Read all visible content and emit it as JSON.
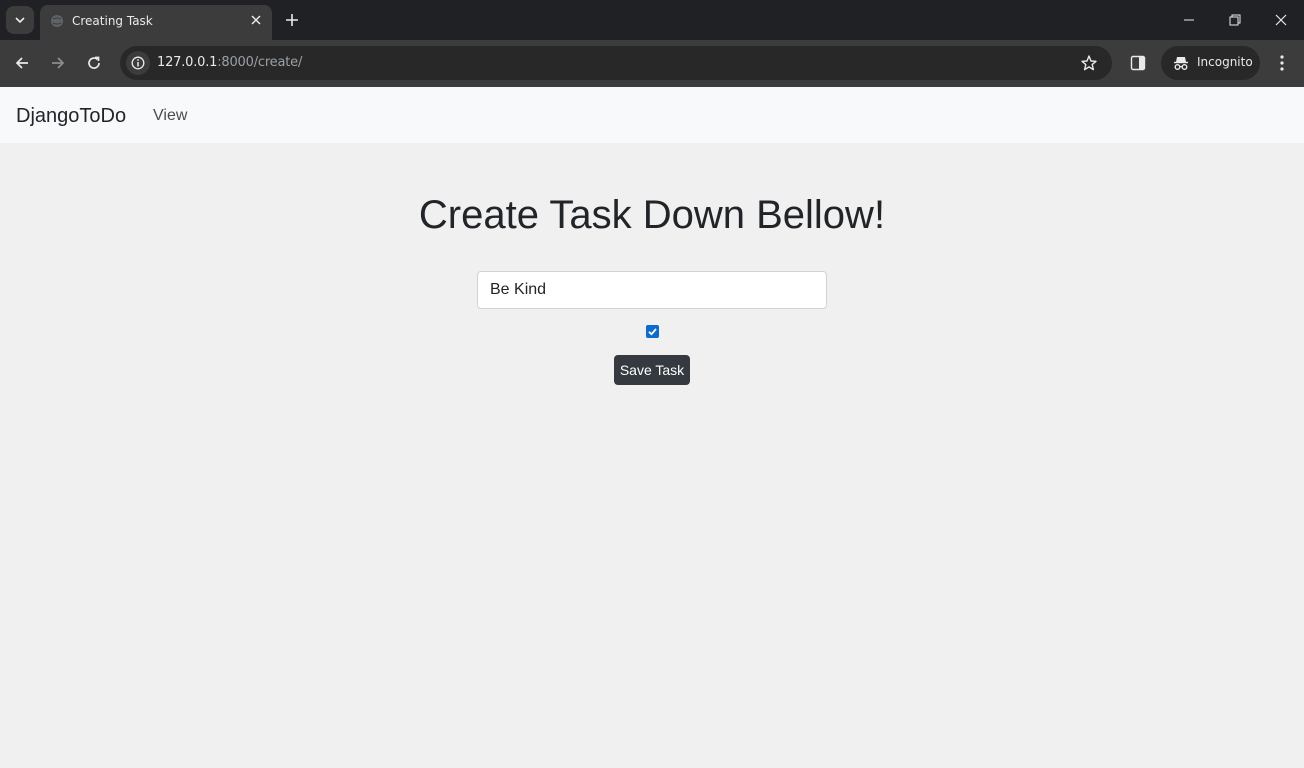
{
  "browser": {
    "tab_title": "Creating Task",
    "url_host": "127.0.0.1",
    "url_rest": ":8000/create/",
    "profile_label": "Incognito"
  },
  "navbar": {
    "brand": "DjangoToDo",
    "links": [
      {
        "label": "View"
      }
    ]
  },
  "main": {
    "heading": "Create Task Down Bellow!",
    "task_input_value": "Be Kind",
    "completed_checked": true,
    "save_label": "Save Task"
  },
  "colors": {
    "page_bg": "#f0f0f0",
    "navbar_bg": "#f8f9fa",
    "button_bg": "#343a40",
    "checkbox_accent": "#0b6bd3"
  }
}
